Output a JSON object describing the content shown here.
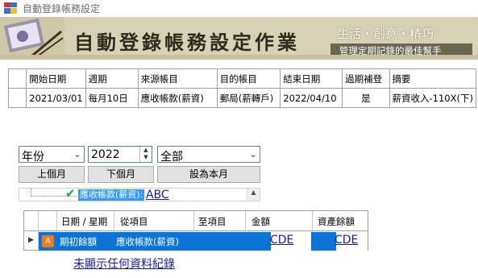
{
  "window": {
    "title": "自動登錄帳務設定"
  },
  "banner": {
    "title": "自動登錄帳務設定作業",
    "slogan": "生活・創意・精巧",
    "subtitle": "管理定期記錄的最佳幫手"
  },
  "schedule_table": {
    "headers": [
      "開始日期",
      "週期",
      "來源帳目",
      "目的帳目",
      "結束日期",
      "過期補登",
      "摘要"
    ],
    "rows": [
      [
        "2021/03/01",
        "每月10日",
        "應收帳款(薪資)",
        "郵局(薪轉戶)",
        "2022/04/10",
        "是",
        "薪資收入-110X(下)"
      ]
    ]
  },
  "filter": {
    "period_select": "年份",
    "year_value": "2022",
    "scope_select": "全部",
    "prev_month_label": "上個月",
    "next_month_label": "下個月",
    "set_this_month_label": "設為本月"
  },
  "tree": {
    "node_label": "應收帳款(薪資):",
    "node_link": "ABC"
  },
  "ledger_grid": {
    "headers": [
      "日期 / 星期",
      "從項目",
      "至項目",
      "金額",
      "資產餘額"
    ],
    "row": {
      "type_badge": "A",
      "date": "期初餘額",
      "from": "應收帳款(薪資)",
      "to": "",
      "amount": "CDE",
      "balance": "CDE"
    },
    "empty_message": "未顯示任何資料紀錄"
  }
}
